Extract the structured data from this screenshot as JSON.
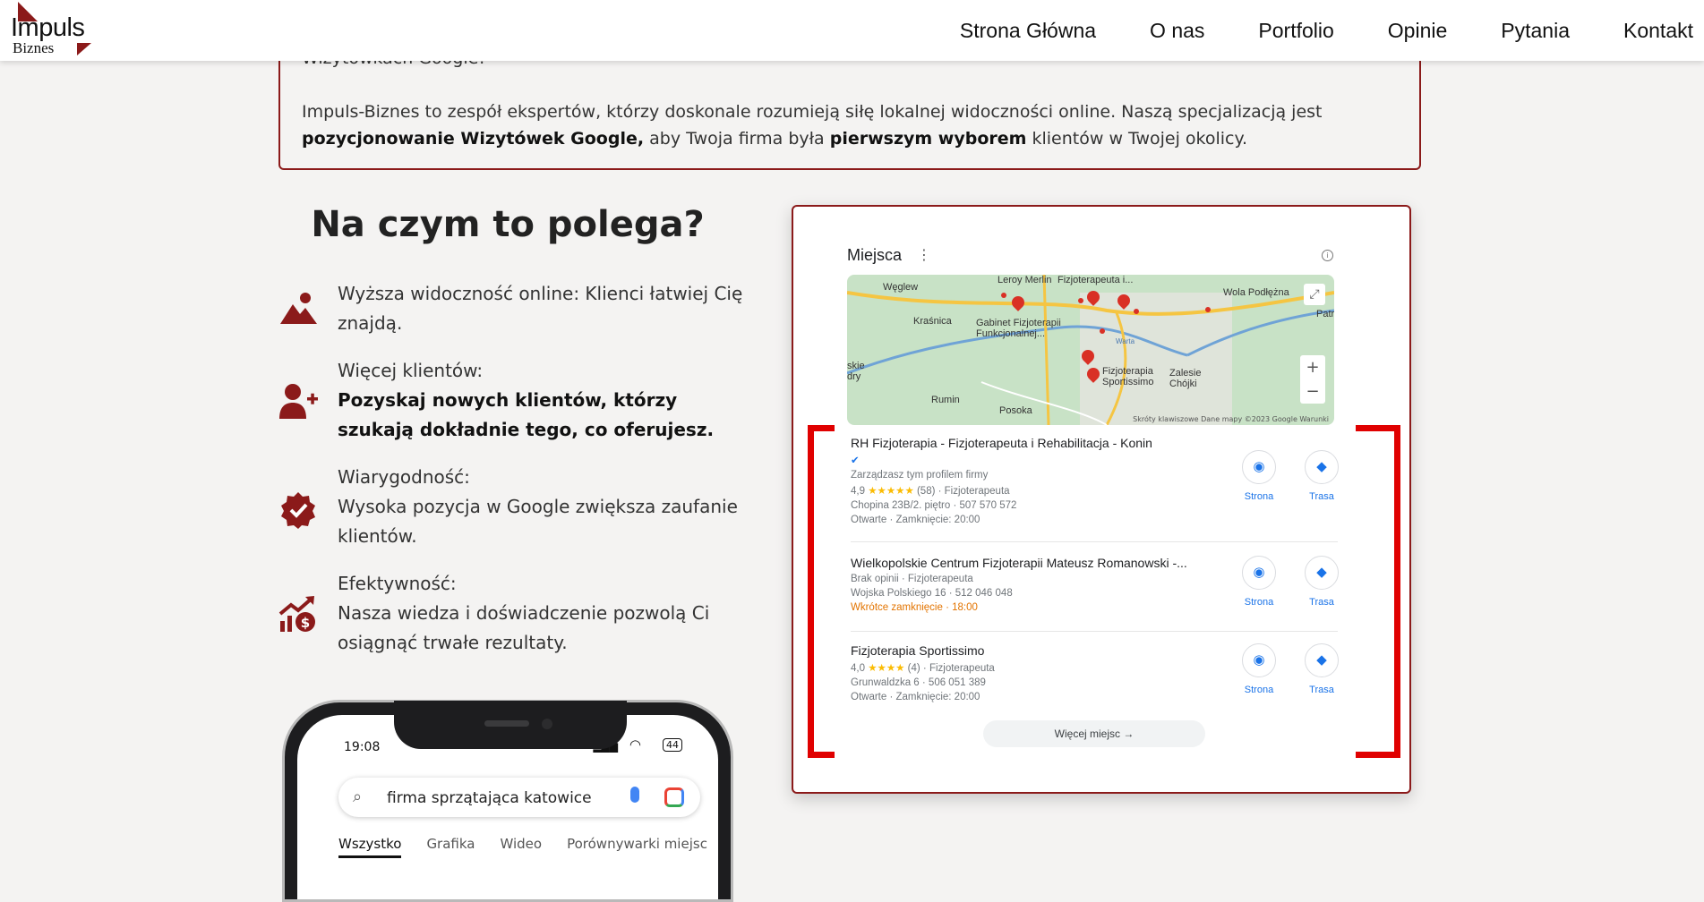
{
  "logo": {
    "line1": "Impuls",
    "line2": "Biznes"
  },
  "nav": [
    "Strona Główna",
    "O nas",
    "Portfolio",
    "Opinie",
    "Pytania",
    "Kontakt"
  ],
  "intro": {
    "cut_text": "Wizytówkach Google!",
    "p_start": "Impuls-Biznes to zespół ekspertów, którzy doskonale rozumieją siłę lokalnej widoczności online. Naszą specjalizacją jest ",
    "p_bold1": "pozycjonowanie Wizytówek Google,",
    "p_mid": " aby Twoja firma była ",
    "p_bold2": "pierwszym wyborem",
    "p_end": " klientów w Twojej okolicy."
  },
  "section_title": "Na czym to polega?",
  "features": [
    {
      "icon": "mountain-icon",
      "title": "Wyższa widoczność online: Klienci łatwiej Cię znajdą."
    },
    {
      "icon": "user-plus-icon",
      "title": "Więcej klientów:",
      "bold": "Pozyskaj nowych klientów, którzy szukają dokładnie tego, co oferujesz."
    },
    {
      "icon": "badge-check-icon",
      "title": "Wiarygodność:",
      "text": "Wysoka pozycja w Google zwiększa zaufanie klientów."
    },
    {
      "icon": "chart-growth-icon",
      "title": "Efektywność:",
      "text": "Nasza wiedza i doświadczenie pozwolą Ci osiągnąć trwałe rezultaty."
    }
  ],
  "phone": {
    "time": "19:08",
    "battery": "44",
    "query": "firma sprzątająca katowice",
    "tabs": [
      "Wszystko",
      "Grafika",
      "Wideo",
      "Porównywarki miejsc"
    ]
  },
  "map_card": {
    "title": "Miejsca",
    "map_labels": [
      "Węglew",
      "Leroy Merlin",
      "Fizjoterapeuta i...",
      "Wola Podłężna",
      "Kraśnica",
      "Gabinet Fizjoterapii Funkcjonalnej...",
      "Patr",
      "Fizjoterapia Sportissimo",
      "Zalesie Chójki",
      "Rumin",
      "Posoka",
      "skie dry",
      "Warta"
    ],
    "map_footer": "Skróty klawiszowe   Dane mapy ©2023 Google   Warunki",
    "businesses": [
      {
        "name": "RH Fizjoterapia - Fizjoterapeuta i Rehabilitacja - Konin",
        "verified": "✔",
        "managed": "Zarządzasz tym profilem firmy",
        "rating": "4,9",
        "stars": "★★★★★",
        "reviews": "(58)",
        "category": "Fizjoterapeuta",
        "address": "Chopina 23B/2. piętro · 507 570 572",
        "status": "Otwarte · Zamknięcie: 20:00"
      },
      {
        "name": "Wielkopolskie Centrum Fizjoterapii Mateusz Romanowski -...",
        "line1": "Brak opinii · Fizjoterapeuta",
        "address": "Wojska Polskiego 16 · 512 046 048",
        "status": "Wkrótce zamknięcie · 18:00"
      },
      {
        "name": "Fizjoterapia Sportissimo",
        "rating": "4,0",
        "stars": "★★★★",
        "reviews": "(4)",
        "category": "Fizjoterapeuta",
        "address": "Grunwaldzka 6 · 506 051 389",
        "status": "Otwarte · Zamknięcie: 20:00"
      }
    ],
    "action_site": "Strona",
    "action_route": "Trasa",
    "more": "Więcej miejsc →"
  }
}
